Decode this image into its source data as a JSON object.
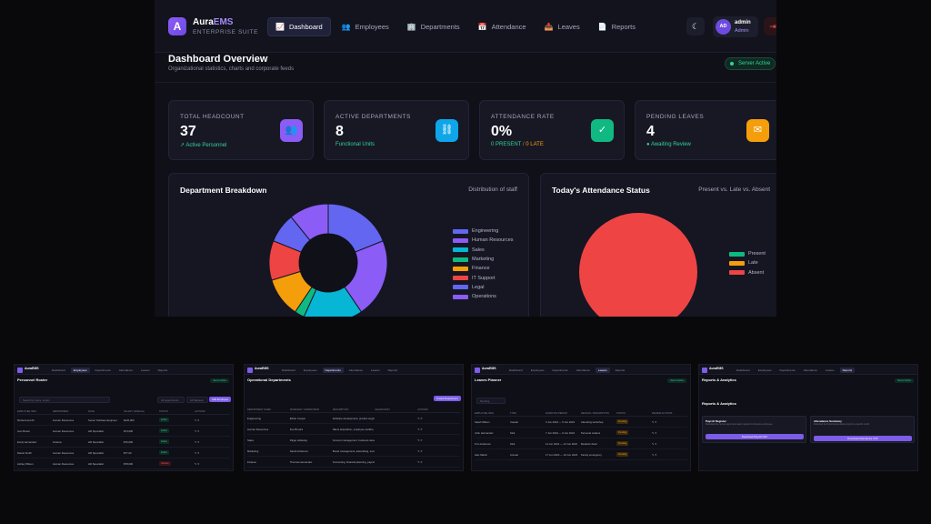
{
  "brand": {
    "name_prefix": "Aura",
    "name_suffix": "EMS",
    "subtitle": "ENTERPRISE SUITE",
    "logo_letter": "A"
  },
  "nav": [
    {
      "label": "Dashboard",
      "icon": "chart-line-icon",
      "glyph": "📈",
      "active": true
    },
    {
      "label": "Employees",
      "icon": "users-icon",
      "glyph": "👥",
      "active": false
    },
    {
      "label": "Departments",
      "icon": "sitemap-icon",
      "glyph": "🏢",
      "active": false
    },
    {
      "label": "Attendance",
      "icon": "calendar-icon",
      "glyph": "📅",
      "active": false
    },
    {
      "label": "Leaves",
      "icon": "inbox-icon",
      "glyph": "📥",
      "active": false
    },
    {
      "label": "Reports",
      "icon": "file-icon",
      "glyph": "📄",
      "active": false
    }
  ],
  "header": {
    "theme_icon": "moon-icon",
    "logout_icon": "logout-icon"
  },
  "user": {
    "initials": "AD",
    "name": "admin",
    "role": "Admin"
  },
  "page": {
    "title": "Dashboard Overview",
    "subtitle": "Organizational statistics, charts and corporate feeds",
    "server_status": "Server Active"
  },
  "cards": [
    {
      "label": "TOTAL HEADCOUNT",
      "value": "37",
      "sub": "↗ Active Personnel",
      "sub_color": "#34d399",
      "icon": "users-icon",
      "glyph": "👥",
      "color": "#8b5cf6"
    },
    {
      "label": "ACTIVE DEPARTMENTS",
      "value": "8",
      "sub": "Functional Units",
      "sub_color": "#34d399",
      "icon": "sitemap-icon",
      "glyph": "⛓",
      "color": "#0ea5e9"
    },
    {
      "label": "ATTENDANCE RATE",
      "value": "0%",
      "sub_present": "0 PRESENT",
      "sub_sep": " / ",
      "sub_late": "0 LATE",
      "icon": "calendar-check-icon",
      "glyph": "✓",
      "color": "#10b981"
    },
    {
      "label": "PENDING LEAVES",
      "value": "4",
      "sub": "● Awaiting Review",
      "sub_color": "#34d399",
      "icon": "mail-icon",
      "glyph": "✉",
      "color": "#f59e0b"
    }
  ],
  "chart_data": [
    {
      "type": "pie",
      "title": "Department Breakdown",
      "subtitle": "Distribution of staff",
      "donut": true,
      "legend_position": "right",
      "categories": [
        "Engineering",
        "Human Resources",
        "Sales",
        "Marketing",
        "Finance",
        "IT Support",
        "Legal",
        "Operations"
      ],
      "values": [
        7,
        8,
        6,
        1,
        4,
        4,
        3,
        4
      ],
      "colors": [
        "#6366f1",
        "#8b5cf6",
        "#06b6d4",
        "#10b981",
        "#f59e0b",
        "#ef4444",
        "#6366f1",
        "#8b5cf6"
      ]
    },
    {
      "type": "pie",
      "title": "Today's Attendance Status",
      "subtitle": "Present vs. Late vs. Absent",
      "donut": false,
      "legend_position": "right",
      "categories": [
        "Present",
        "Late",
        "Absent"
      ],
      "values": [
        0,
        0,
        37
      ],
      "colors": [
        "#10b981",
        "#f59e0b",
        "#ef4444"
      ]
    }
  ],
  "thumbnails": {
    "employees": {
      "title": "Personnel Roster",
      "search_placeholder": "Search by name, email...",
      "filter_departments": "All departments",
      "filter_status": "All Statuses",
      "add_button": "Add Employee",
      "columns": [
        "EMPLOYEE INFO",
        "DEPARTMENT",
        "ROLE",
        "SALARY (ANNUAL)",
        "STATUS",
        "ACTIONS"
      ],
      "rows": [
        [
          "Mohammed Ali",
          "Human Resources",
          "Senior Software Engineer",
          "$120,000",
          "Active"
        ],
        [
          "Ivan Brown",
          "Human Resources",
          "HR Specialist",
          "$74,000",
          "Active"
        ],
        [
          "Emily Hernandez",
          "Finance",
          "HR Specialist",
          "$76,000",
          "Active"
        ],
        [
          "Daniel Smith",
          "Human Resources",
          "HR Specialist",
          "$77,00",
          "Active"
        ],
        [
          "Ashley Wilson",
          "Human Resources",
          "HR Specialist",
          "$78,000",
          "Inactive"
        ]
      ]
    },
    "departments": {
      "title": "Operational Departments",
      "add_button": "Create Department",
      "columns": [
        "DEPARTMENT NAME",
        "MANAGER / SUPERVISOR",
        "DESCRIPTION",
        "HEADCOUNT",
        "ACTIONS"
      ],
      "rows": [
        [
          "Engineering",
          "Ethan Cooper",
          "Software development, product engineering, QA, and op..."
        ],
        [
          "Human Resources",
          "Zoe Brooks",
          "Talent acquisition, employee welfare, operations, and..."
        ],
        [
          "Sales",
          "Paige Holloway",
          "Account management, business development, and sales..."
        ],
        [
          "Marketing",
          "Sarah Anderson",
          "Brand management, advertising, social media, and web..."
        ],
        [
          "Finance",
          "Thomas Hernandez",
          "Accounting, financial planning, payroll processing, and a..."
        ],
        [
          "IT Support",
          "",
          "Technical infrastructure, helpdesk, network and security..."
        ]
      ]
    },
    "leaves": {
      "title": "Leaves Planner",
      "filter": "Pending",
      "columns": [
        "EMPLOYEE INFO",
        "TYPE",
        "DURATION PERIOD",
        "REASON / DESCRIPTION",
        "STATUS",
        "REVIEW ACTIONS"
      ],
      "rows": [
        [
          "Sarah Wilson",
          "Casual",
          "3 Jun 2024 — 5 Jun 2024",
          "Attending workshop",
          "Pending"
        ],
        [
          "John Hernandez",
          "Sick",
          "7 Jun 2024 — 9 Jun 2024",
          "Personal matters",
          "Pending"
        ],
        [
          "Tom Anderson",
          "Sick",
          "11 Jun 2024 — 13 Jun 2024",
          "Medical check",
          "Pending"
        ],
        [
          "Alex Martin",
          "Annual",
          "17 Jun 2024 — 19 Jun 2024",
          "Family emergency",
          "Pending"
        ]
      ]
    },
    "reports": {
      "title": "Reports & Analytics",
      "payroll_title": "Payroll Register",
      "payroll_desc": "Download the current payroll and salary register for all active employees.",
      "payroll_button": "Download Payroll CSV",
      "attendance_title": "Attendance Summary",
      "attendance_desc": "Download the historical attendance logs for a specific month.",
      "attendance_button": "Download Attendance CSV"
    }
  }
}
